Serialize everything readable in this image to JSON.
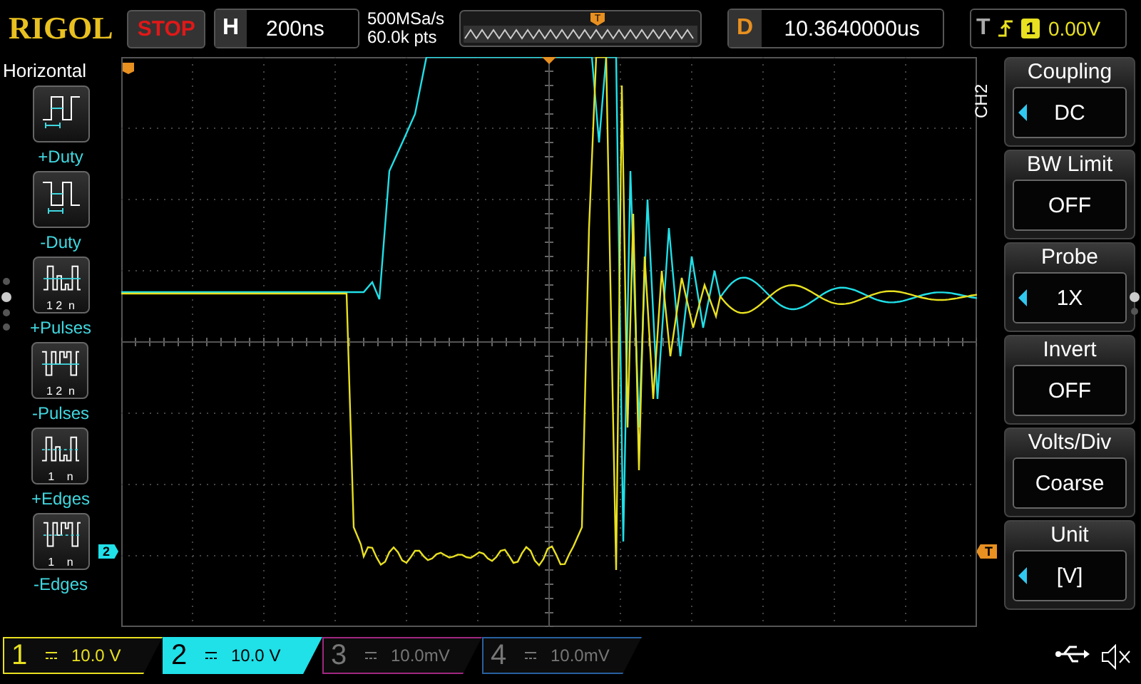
{
  "logo": "RIGOL",
  "run_state": "STOP",
  "timebase": {
    "label": "H",
    "value": "200ns"
  },
  "sample": {
    "rate": "500MSa/s",
    "depth": "60.0k pts"
  },
  "memory_bar": {
    "marker": "T"
  },
  "delay": {
    "label": "D",
    "value": "10.3640000us"
  },
  "trigger": {
    "label": "T",
    "source": "1",
    "level": "0.00V"
  },
  "left_menu": {
    "title": "Horizontal",
    "items": [
      {
        "label": "+Duty",
        "kind": "pos-duty"
      },
      {
        "label": "-Duty",
        "kind": "neg-duty"
      },
      {
        "label": "+Pulses",
        "kind": "pos-pulses",
        "index_label": "1 2  n"
      },
      {
        "label": "-Pulses",
        "kind": "neg-pulses",
        "index_label": "1 2  n"
      },
      {
        "label": "+Edges",
        "kind": "pos-edges",
        "index_label": "1    n"
      },
      {
        "label": "-Edges",
        "kind": "neg-edges",
        "index_label": "1    n"
      }
    ],
    "page_dots": [
      {
        "selected": false
      },
      {
        "selected": true
      },
      {
        "selected": false
      },
      {
        "selected": false
      }
    ]
  },
  "plot": {
    "markers": [
      {
        "label": "2",
        "kind": "channel"
      },
      {
        "label": "T",
        "kind": "trigger"
      }
    ]
  },
  "right_menu": {
    "channel": "CH2",
    "items": [
      {
        "title": "Coupling",
        "value": "DC",
        "adjustable": true
      },
      {
        "title": "BW Limit",
        "value": "OFF",
        "adjustable": false
      },
      {
        "title": "Probe",
        "value": "1X",
        "adjustable": true
      },
      {
        "title": "Invert",
        "value": "OFF",
        "adjustable": false
      },
      {
        "title": "Volts/Div",
        "value": "Coarse",
        "adjustable": false
      },
      {
        "title": "Unit",
        "value": "[V]",
        "adjustable": true
      }
    ],
    "page_dots": [
      {
        "selected": true
      },
      {
        "selected": false
      }
    ]
  },
  "channels": [
    {
      "number": "1",
      "value": "10.0 V",
      "color": "#e8e020",
      "enabled": true,
      "selected": false
    },
    {
      "number": "2",
      "value": "10.0 V",
      "color": "#20e0e8",
      "enabled": true,
      "selected": true
    },
    {
      "number": "3",
      "value": "10.0mV",
      "color": "#a02880",
      "enabled": false,
      "selected": false
    },
    {
      "number": "4",
      "value": "10.0mV",
      "color": "#2860a0",
      "enabled": false,
      "selected": false
    }
  ]
}
